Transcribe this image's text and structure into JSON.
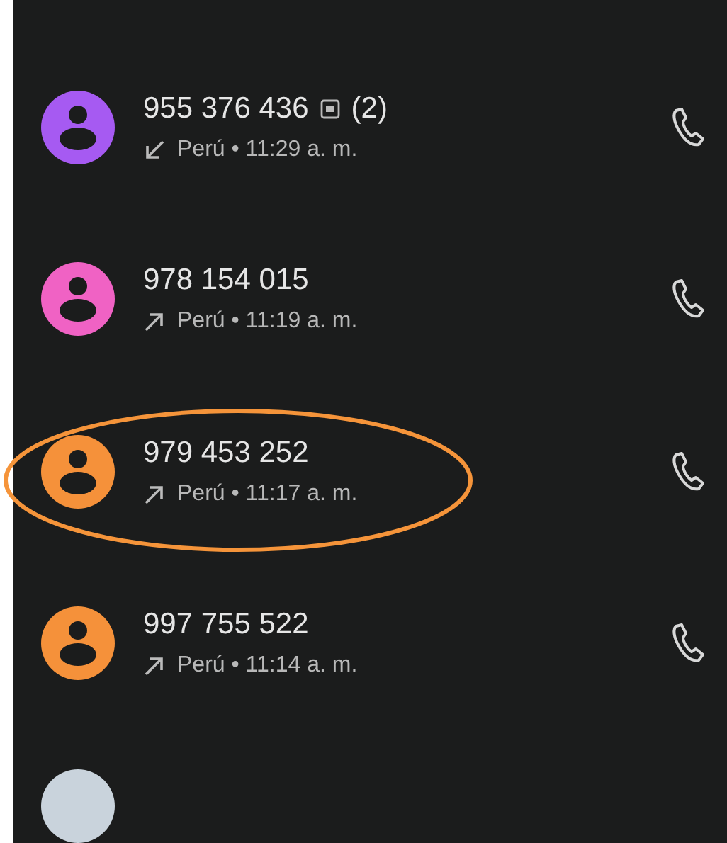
{
  "calls": [
    {
      "number": "955 376 436",
      "count": "(2)",
      "sim_icon": true,
      "kind": "incoming",
      "detail": "Perú • 11:29 a. m.",
      "color": "#a65af2",
      "highlighted": false
    },
    {
      "number": "978 154 015",
      "sim_icon": false,
      "kind": "outgoing",
      "detail": "Perú • 11:19 a. m.",
      "color": "#f062c4",
      "highlighted": false
    },
    {
      "number": "979 453 252",
      "sim_icon": false,
      "kind": "outgoing",
      "detail": "Perú • 11:17 a. m.",
      "color": "#f5913a",
      "highlighted": true
    },
    {
      "number": "997 755 522",
      "sim_icon": false,
      "kind": "outgoing",
      "detail": "Perú • 11:14 a. m.",
      "color": "#f5913a",
      "highlighted": false
    }
  ],
  "peek": {
    "color": "#c9d3dc"
  }
}
